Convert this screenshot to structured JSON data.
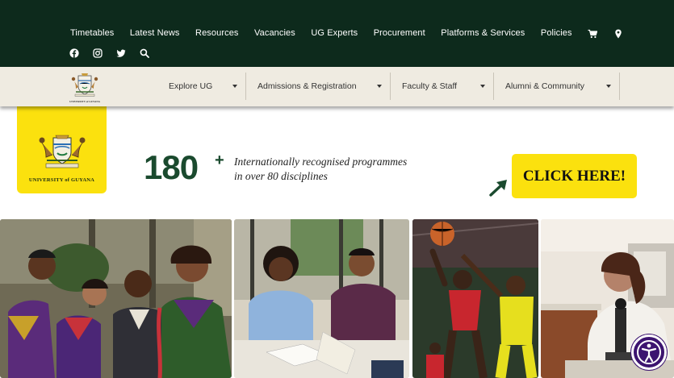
{
  "top_nav": {
    "links": [
      "Timetables",
      "Latest News",
      "Resources",
      "Vacancies",
      "UG Experts",
      "Procurement",
      "Platforms & Services",
      "Policies"
    ],
    "icons": [
      "cart-icon",
      "location-pin-icon"
    ]
  },
  "social": [
    "facebook-icon",
    "instagram-icon",
    "twitter-icon",
    "search-icon"
  ],
  "main_nav": {
    "logo_text": "UNIVERSITY of GUYANA",
    "items": [
      {
        "label": "Explore UG"
      },
      {
        "label": "Admissions & Registration"
      },
      {
        "label": "Faculty & Staff"
      },
      {
        "label": "Alumni & Community"
      }
    ]
  },
  "hero": {
    "logo_text": "UNIVERSITY of GUYANA",
    "stat_number": "180",
    "stat_plus": "+",
    "tagline_line1": "Internationally recognised programmes",
    "tagline_line2": "in over 80 disciplines",
    "cta_label": "CLICK HERE!"
  },
  "photos": [
    "graduates-photo",
    "students-studying-photo",
    "basketball-photo",
    "laboratory-photo"
  ],
  "colors": {
    "dark_green": "#0d2a1c",
    "brand_green": "#1a4a2e",
    "yellow": "#fbe10e",
    "nav_bg": "#efebe1",
    "accessibility_purple": "#3c1470"
  }
}
